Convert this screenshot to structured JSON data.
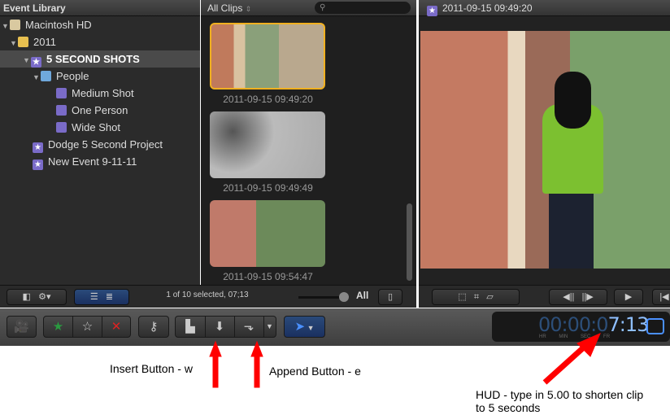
{
  "library": {
    "title": "Event Library",
    "items": [
      {
        "label": "Macintosh HD",
        "icon": "hard-drive-icon"
      },
      {
        "label": "2011",
        "icon": "calendar-icon"
      },
      {
        "label": "5 SECOND SHOTS",
        "icon": "event-star-icon",
        "selected": true
      },
      {
        "label": "People",
        "icon": "folder-icon"
      },
      {
        "label": "Medium Shot",
        "icon": "keyword-collection-icon"
      },
      {
        "label": "One Person",
        "icon": "keyword-collection-icon"
      },
      {
        "label": "Wide Shot",
        "icon": "keyword-collection-icon"
      },
      {
        "label": "Dodge 5 Second Project",
        "icon": "event-star-icon"
      },
      {
        "label": "New Event 9-11-11",
        "icon": "event-star-icon"
      }
    ]
  },
  "browser": {
    "filter": "All Clips",
    "search_placeholder": "",
    "clips": [
      {
        "label": "2011-09-15 09:49:20",
        "selected": true
      },
      {
        "label": "2011-09-15 09:49:49"
      },
      {
        "label": "2011-09-15 09:54:47"
      }
    ],
    "status": "1 of 10 selected, 07;13",
    "zoom_label": "All"
  },
  "viewer": {
    "title": "2011-09-15 09:49:20"
  },
  "timecode": {
    "dim": "00:00:0",
    "bright": "7:13",
    "units": [
      "HR",
      "MIN",
      "SEC",
      "FR"
    ]
  },
  "annotations": {
    "insert": "Insert Button - w",
    "append": "Append Button - e",
    "hud": "HUD - type in 5.00 to shorten clip to 5 seconds",
    "color": "#ff0000"
  }
}
